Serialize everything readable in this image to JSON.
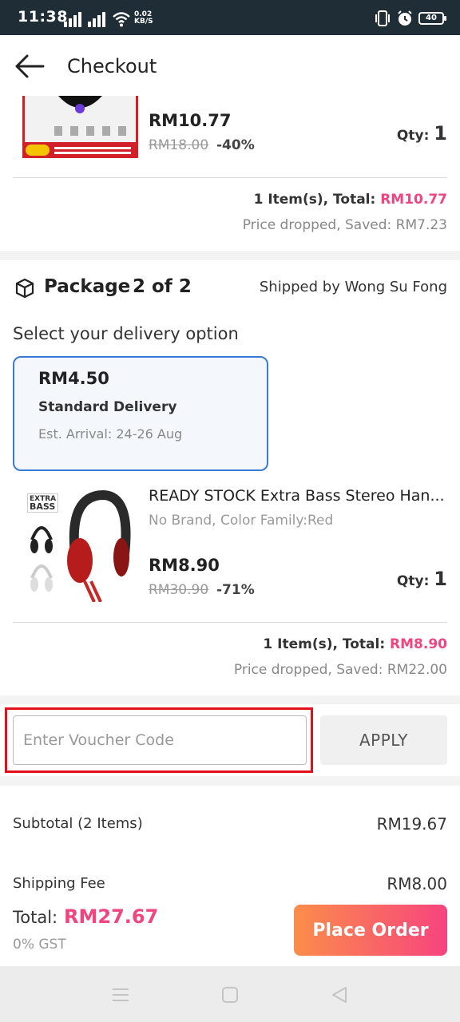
{
  "status_bar": {
    "time": "11:38",
    "net_speed_value": "0.02",
    "net_speed_unit": "KB/S",
    "battery": "40",
    "icons": [
      "signal-icon",
      "signal-icon",
      "wifi-icon",
      "vibrate-icon",
      "alarm-icon",
      "battery-icon"
    ]
  },
  "header": {
    "title": "Checkout",
    "back_icon": "arrow-left-icon"
  },
  "package1": {
    "price": "RM10.77",
    "original_price": "RM18.00",
    "discount": "-40%",
    "qty_label": "Qty:",
    "qty": "1",
    "total_prefix": "1 Item(s), Total:",
    "total_value": "RM10.77",
    "saved_text": "Price dropped, Saved:  RM7.23"
  },
  "package2": {
    "icon": "box-icon",
    "title": "Package",
    "count": "2 of 2",
    "shipped_by": "Shipped by Wong Su Fong",
    "select_delivery": "Select your delivery option",
    "delivery": {
      "price": "RM4.50",
      "name": "Standard Delivery",
      "eta": "Est. Arrival: 24-26 Aug"
    },
    "product": {
      "name": "READY STOCK Extra Bass Stereo Han...",
      "variant": "No Brand, Color Family:Red",
      "price": "RM8.90",
      "original_price": "RM30.90",
      "discount": "-71%",
      "qty_label": "Qty:",
      "qty": "1",
      "image_text_1": "EXTRA",
      "image_text_2": "BASS"
    },
    "total_prefix": "1 Item(s), Total:",
    "total_value": "RM8.90",
    "saved_text": "Price dropped, Saved:  RM22.00"
  },
  "voucher": {
    "placeholder": "Enter Voucher Code",
    "apply_label": "APPLY"
  },
  "summary": {
    "subtotal_label": "Subtotal (2 Items)",
    "subtotal_value": "RM19.67",
    "shipping_label": "Shipping Fee",
    "shipping_value": "RM8.00"
  },
  "footer": {
    "total_label": "Total:",
    "total_value": "RM27.67",
    "gst": "0% GST",
    "place_order": "Place Order"
  },
  "colors": {
    "accent_pink": "#f0457e",
    "button_orange": "#fb8d4a",
    "delivery_border": "#3a7ad9",
    "highlight_red": "#e3101c",
    "status_bar": "#1f2d36"
  }
}
